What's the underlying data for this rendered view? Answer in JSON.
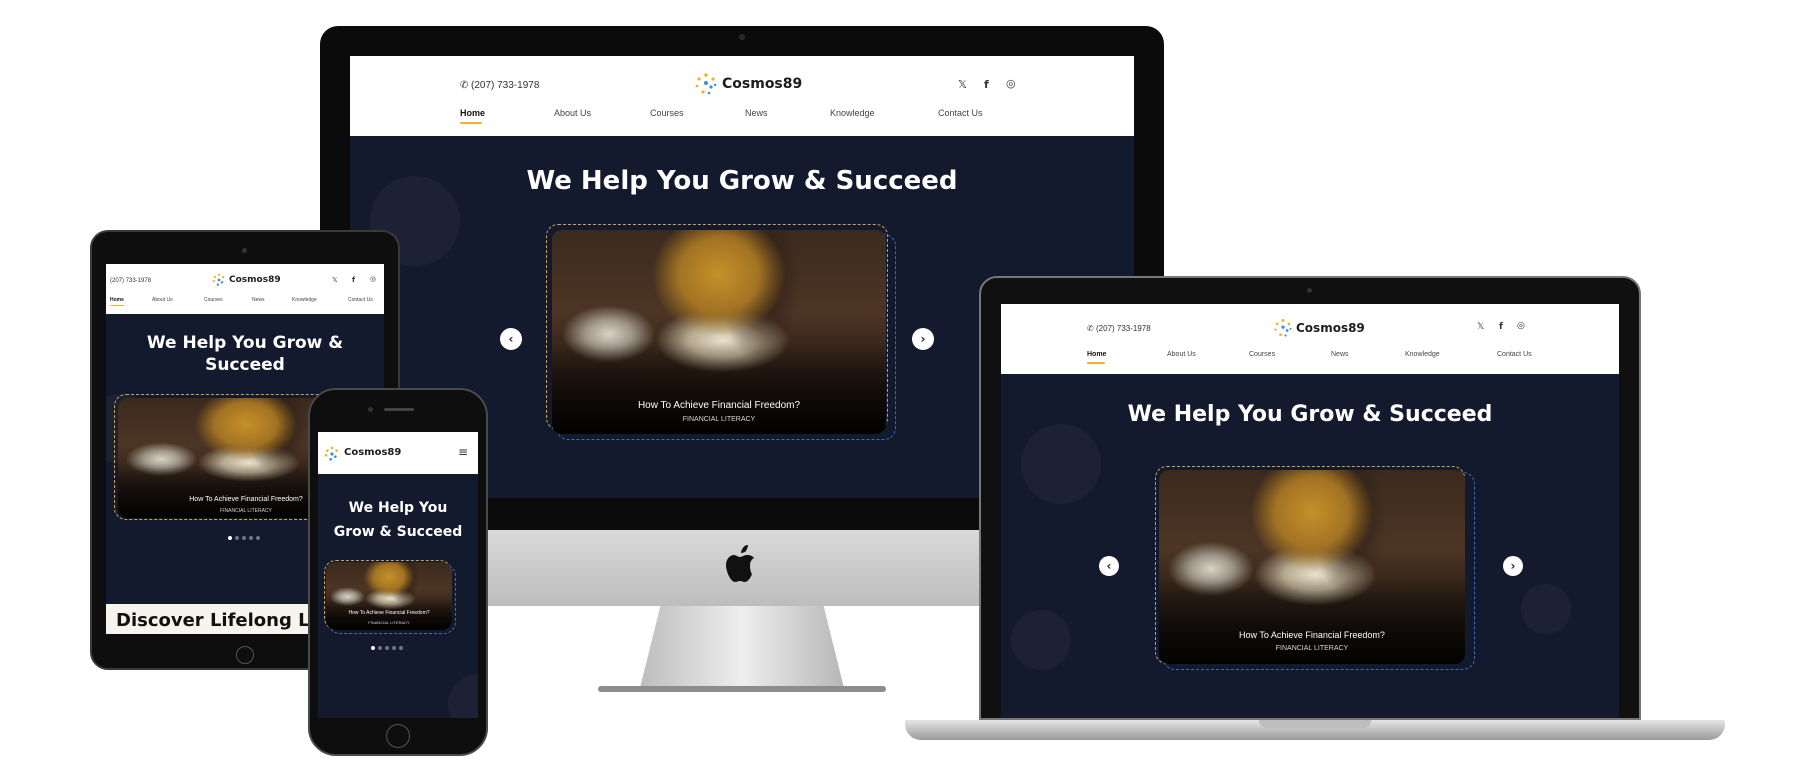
{
  "site": {
    "phone": "(207) 733-1978",
    "brand": "Cosmos89",
    "hero_title": "We Help You Grow & Succeed",
    "card_title": "How To Achieve Financial Freedom?",
    "card_category": "FINANCIAL LITERACY",
    "next_section_title": "Discover Lifelong Le"
  },
  "nav": {
    "items": [
      "Home",
      "About Us",
      "Courses",
      "News",
      "Knowledge",
      "Contact Us"
    ]
  },
  "icons": {
    "social": [
      "twitter-icon",
      "facebook-icon",
      "instagram-icon"
    ],
    "arrows": [
      "chevron-left-icon",
      "chevron-right-icon"
    ],
    "menu": "hamburger-icon",
    "apple": "apple-logo"
  },
  "colors": {
    "hero_bg": "#141a2e",
    "accent": "#f2b02b",
    "frame_dash_gold": "#cfa245",
    "frame_dash_blue": "#3b6fb1"
  },
  "carousel": {
    "slide_count": 5,
    "active_slide": 1
  }
}
